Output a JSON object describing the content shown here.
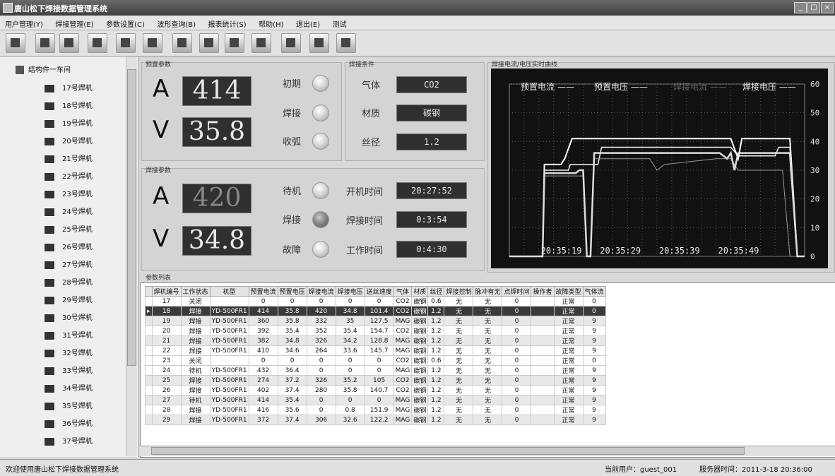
{
  "window": {
    "title": "唐山松下焊接数据管理系统"
  },
  "menu": [
    "用户管理(Y)",
    "焊接管理(E)",
    "参数设置(C)",
    "波形查询(B)",
    "报表统计(S)",
    "帮助(H)",
    "退出(E)",
    "测试"
  ],
  "toolbar": [
    "tool-icon-1",
    "tool-icon-2",
    "tool-icon-3",
    "tool-icon-4",
    "tool-icon-5",
    "tool-icon-6",
    "tool-icon-7",
    "tool-icon-8",
    "tool-icon-9",
    "tool-icon-10",
    "tool-icon-11",
    "tool-icon-12",
    "tool-icon-13"
  ],
  "tree": {
    "root": "结构件一车间",
    "items": [
      "17号焊机",
      "18号焊机",
      "19号焊机",
      "20号焊机",
      "21号焊机",
      "22号焊机",
      "23号焊机",
      "24号焊机",
      "25号焊机",
      "26号焊机",
      "27号焊机",
      "28号焊机",
      "29号焊机",
      "30号焊机",
      "31号焊机",
      "32号焊机",
      "33号焊机",
      "34号焊机",
      "35号焊机",
      "36号焊机",
      "37号焊机"
    ]
  },
  "preset": {
    "title": "预置参数",
    "a_symbol": "A",
    "v_symbol": "V",
    "current": "414",
    "voltage": "35.8",
    "lamps": [
      "初期",
      "焊接",
      "收弧"
    ]
  },
  "conditions": {
    "title": "焊接条件",
    "labels": [
      "气体",
      "材质",
      "丝径"
    ],
    "values": [
      "CO2",
      "碳钢",
      "1.2"
    ]
  },
  "welding": {
    "title": "焊接参数",
    "a_symbol": "A",
    "v_symbol": "V",
    "current": "420",
    "voltage": "34.8",
    "lamps": [
      "待机",
      "焊接",
      "故障"
    ],
    "time_labels": [
      "开机时间",
      "焊接时间",
      "工作时间"
    ],
    "time_values": [
      "20:27:52",
      "0:3:54",
      "0:4:30"
    ]
  },
  "chart_data": {
    "title": "焊接电流/电压实时曲线",
    "type": "line",
    "legend": [
      "预置电流",
      "预置电压",
      "焊接电流",
      "焊接电压"
    ],
    "x": [
      "20:35:19",
      "20:35:29",
      "20:35:39",
      "20:35:49"
    ],
    "ylim": [
      0,
      60
    ],
    "yticks": [
      0,
      10,
      20,
      30,
      40,
      50,
      60
    ],
    "series": [
      {
        "name": "预置电流",
        "points": [
          [
            0,
            0
          ],
          [
            9,
            0
          ],
          [
            9.5,
            30
          ],
          [
            16,
            30
          ],
          [
            16.5,
            32
          ],
          [
            24,
            32
          ],
          [
            25,
            38
          ],
          [
            60,
            38
          ],
          [
            62,
            35
          ],
          [
            72,
            35
          ],
          [
            73,
            38
          ],
          [
            76,
            38
          ],
          [
            78,
            0
          ],
          [
            80,
            0
          ]
        ]
      },
      {
        "name": "预置电压",
        "points": [
          [
            0,
            0
          ],
          [
            9,
            0
          ],
          [
            9.5,
            32
          ],
          [
            14,
            32
          ],
          [
            15,
            34
          ],
          [
            17,
            41
          ],
          [
            60,
            41
          ],
          [
            62,
            34
          ],
          [
            63,
            41
          ],
          [
            76,
            41
          ],
          [
            78,
            0
          ],
          [
            80,
            0
          ]
        ]
      },
      {
        "name": "焊接电流",
        "points": [
          [
            0,
            0
          ],
          [
            9,
            0
          ],
          [
            9.5,
            28
          ],
          [
            20,
            28
          ],
          [
            21,
            0
          ],
          [
            22,
            0
          ],
          [
            23,
            34
          ],
          [
            38,
            34
          ],
          [
            40,
            30
          ],
          [
            42,
            32
          ],
          [
            56,
            34
          ],
          [
            60,
            34
          ],
          [
            62,
            30
          ],
          [
            74,
            30
          ],
          [
            76,
            0
          ],
          [
            80,
            0
          ]
        ]
      },
      {
        "name": "焊接电压",
        "points": [
          [
            0,
            0
          ],
          [
            9,
            0
          ],
          [
            9.5,
            29
          ],
          [
            18,
            29
          ],
          [
            19,
            30
          ],
          [
            20,
            30
          ],
          [
            21,
            0
          ],
          [
            22,
            0
          ],
          [
            23,
            36
          ],
          [
            57,
            36
          ],
          [
            59,
            34
          ],
          [
            60,
            36
          ],
          [
            61,
            30
          ],
          [
            62,
            36
          ],
          [
            76,
            36
          ],
          [
            78,
            0
          ],
          [
            80,
            0
          ]
        ]
      }
    ],
    "xmax": 80
  },
  "table": {
    "title": "参数列表",
    "columns": [
      "焊机编号",
      "工作状态",
      "机型",
      "预置电流",
      "预置电压",
      "焊接电流",
      "焊接电压",
      "送丝速度",
      "气体",
      "材质",
      "丝径",
      "焊接控制",
      "脉冲有无",
      "点焊时间",
      "操作者",
      "故障类型",
      "气体流"
    ],
    "rows": [
      [
        "17",
        "关闭",
        "",
        "0",
        "0",
        "0",
        "0",
        "0",
        "CO2",
        "碳钢",
        "0.6",
        "无",
        "无",
        "0",
        "",
        "正常",
        "0"
      ],
      [
        "18",
        "焊接",
        "YD-500FR1",
        "414",
        "35.8",
        "420",
        "34.8",
        "101.4",
        "CO2",
        "碳钢",
        "1.2",
        "无",
        "无",
        "0",
        "",
        "正常",
        "0"
      ],
      [
        "19",
        "焊接",
        "YD-500FR1",
        "360",
        "35.8",
        "332",
        "35",
        "127.5",
        "MAG",
        "碳钢",
        "1.2",
        "无",
        "无",
        "0",
        "",
        "正常",
        "9"
      ],
      [
        "20",
        "焊接",
        "YD-500FR1",
        "392",
        "35.4",
        "352",
        "35.4",
        "154.7",
        "CO2",
        "碳钢",
        "1.2",
        "无",
        "无",
        "0",
        "",
        "正常",
        "9"
      ],
      [
        "21",
        "焊接",
        "YD-500FR1",
        "382",
        "34.8",
        "326",
        "34.2",
        "128.8",
        "MAG",
        "碳钢",
        "1.2",
        "无",
        "无",
        "0",
        "",
        "正常",
        "9"
      ],
      [
        "22",
        "焊接",
        "YD-500FR1",
        "410",
        "34.6",
        "264",
        "33.6",
        "145.7",
        "MAG",
        "碳钢",
        "1.2",
        "无",
        "无",
        "0",
        "",
        "正常",
        "9"
      ],
      [
        "23",
        "关闭",
        "",
        "0",
        "0",
        "0",
        "0",
        "0",
        "CO2",
        "碳钢",
        "0.6",
        "无",
        "无",
        "0",
        "",
        "正常",
        "0"
      ],
      [
        "24",
        "待机",
        "YD-500FR1",
        "432",
        "36.4",
        "0",
        "0",
        "0",
        "MAG",
        "碳钢",
        "1.2",
        "无",
        "无",
        "0",
        "",
        "正常",
        "9"
      ],
      [
        "25",
        "焊接",
        "YD-500FR1",
        "274",
        "37.2",
        "326",
        "35.2",
        "105",
        "CO2",
        "碳钢",
        "1.2",
        "无",
        "无",
        "0",
        "",
        "正常",
        "9"
      ],
      [
        "26",
        "焊接",
        "YD-500FR1",
        "402",
        "37.4",
        "280",
        "35.8",
        "140.7",
        "CO2",
        "碳钢",
        "1.2",
        "无",
        "无",
        "0",
        "",
        "正常",
        "9"
      ],
      [
        "27",
        "待机",
        "YD-500FR1",
        "414",
        "35.4",
        "0",
        "0",
        "0",
        "MAG",
        "碳钢",
        "1.2",
        "无",
        "无",
        "0",
        "",
        "正常",
        "9"
      ],
      [
        "28",
        "焊接",
        "YD-500FR1",
        "416",
        "35.6",
        "0",
        "0.8",
        "151.9",
        "MAG",
        "碳钢",
        "1.2",
        "无",
        "无",
        "0",
        "",
        "正常",
        "9"
      ],
      [
        "29",
        "焊接",
        "YD-500FR1",
        "372",
        "37.4",
        "306",
        "32.6",
        "122.2",
        "MAG",
        "碳钢",
        "1.2",
        "无",
        "无",
        "0",
        "",
        "正常",
        "9"
      ]
    ]
  },
  "status": {
    "welcome": "欢迎使用唐山松下焊接数据管理系统",
    "user": "当前用户：guest_001",
    "server_time": "服务器时间：2011-3-18 20:36:00"
  }
}
